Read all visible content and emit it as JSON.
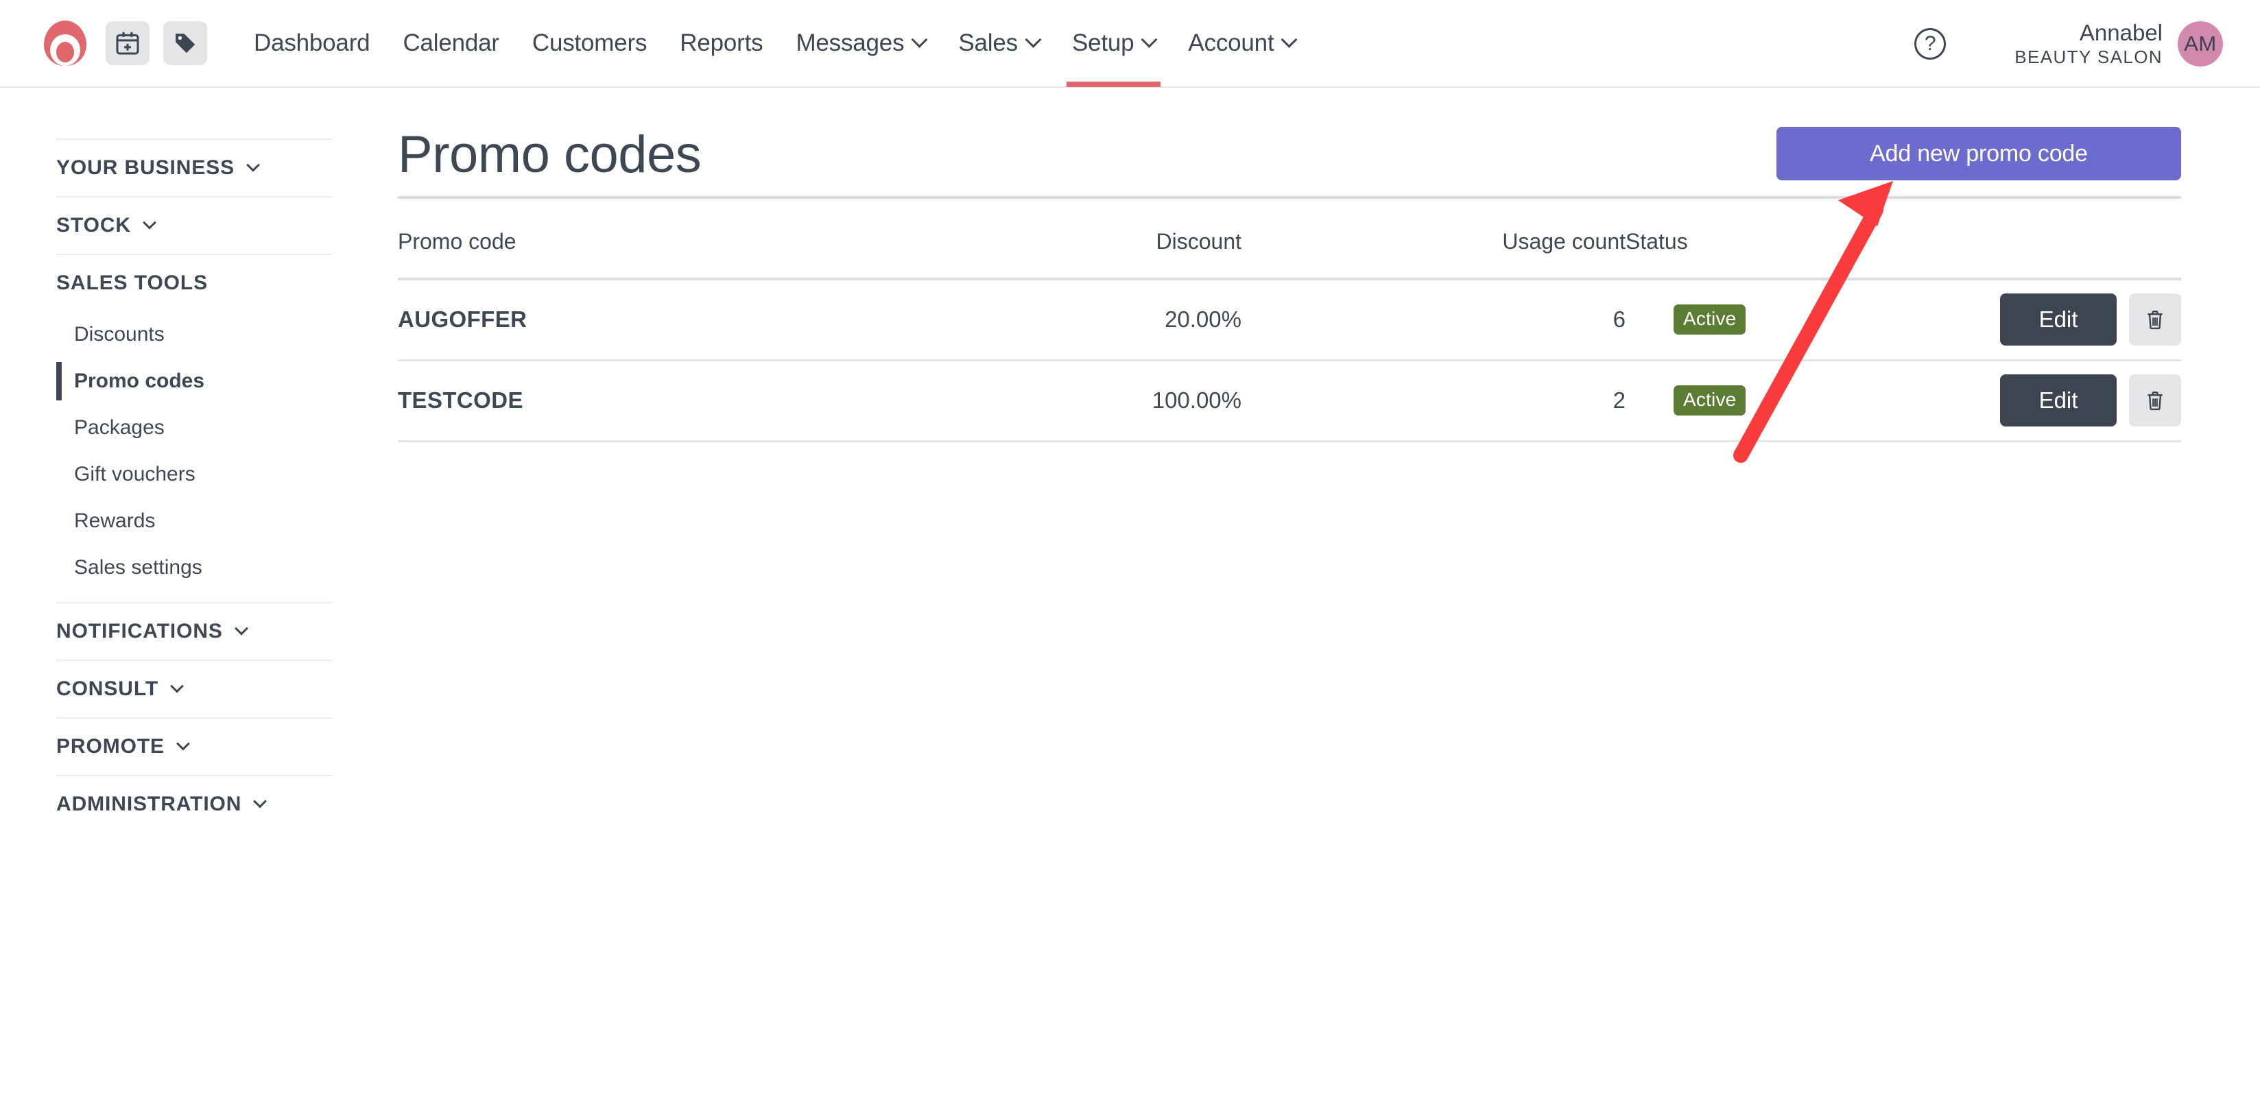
{
  "header": {
    "logo_icon": "logo-circle-icon",
    "quick_actions": [
      {
        "name": "new-appointment-button",
        "icon": "calendar-plus-icon"
      },
      {
        "name": "new-sale-button",
        "icon": "tag-icon"
      }
    ],
    "nav": [
      {
        "label": "Dashboard",
        "has_caret": false,
        "active": false
      },
      {
        "label": "Calendar",
        "has_caret": false,
        "active": false
      },
      {
        "label": "Customers",
        "has_caret": false,
        "active": false
      },
      {
        "label": "Reports",
        "has_caret": false,
        "active": false
      },
      {
        "label": "Messages",
        "has_caret": true,
        "active": false
      },
      {
        "label": "Sales",
        "has_caret": true,
        "active": false
      },
      {
        "label": "Setup",
        "has_caret": true,
        "active": true
      },
      {
        "label": "Account",
        "has_caret": true,
        "active": false
      }
    ],
    "help_label": "?",
    "user": {
      "name": "Annabel",
      "organisation": "BEAUTY SALON",
      "initials": "AM"
    },
    "accent_color": "#e0676b",
    "avatar_color": "#d389ad"
  },
  "sidebar": {
    "groups": [
      {
        "label": "YOUR BUSINESS",
        "caret": true
      },
      {
        "label": "STOCK",
        "caret": true
      },
      {
        "label": "SALES TOOLS",
        "caret": false
      }
    ],
    "sales_tools_items": [
      {
        "label": "Discounts",
        "active": false
      },
      {
        "label": "Promo codes",
        "active": true
      },
      {
        "label": "Packages",
        "active": false
      },
      {
        "label": "Gift vouchers",
        "active": false
      },
      {
        "label": "Rewards",
        "active": false
      },
      {
        "label": "Sales settings",
        "active": false
      }
    ],
    "lower_groups": [
      {
        "label": "NOTIFICATIONS",
        "caret": true
      },
      {
        "label": "CONSULT",
        "caret": true
      },
      {
        "label": "PROMOTE",
        "caret": true
      },
      {
        "label": "ADMINISTRATION",
        "caret": true
      }
    ]
  },
  "main": {
    "title": "Promo codes",
    "add_button_label": "Add new promo code",
    "add_button_color": "#6c6ccf",
    "table": {
      "columns": [
        "Promo code",
        "Discount",
        "Usage count",
        "Status",
        ""
      ],
      "rows": [
        {
          "code": "AUGOFFER",
          "discount": "20.00%",
          "usage_count": "6",
          "status": "Active",
          "status_color": "#5b7d33",
          "edit_label": "Edit",
          "delete_icon": "trash-icon"
        },
        {
          "code": "TESTCODE",
          "discount": "100.00%",
          "usage_count": "2",
          "status": "Active",
          "status_color": "#5b7d33",
          "edit_label": "Edit",
          "delete_icon": "trash-icon"
        }
      ]
    }
  },
  "annotation": {
    "arrow_color": "#f93b3b",
    "points_to": "Add new promo code"
  }
}
